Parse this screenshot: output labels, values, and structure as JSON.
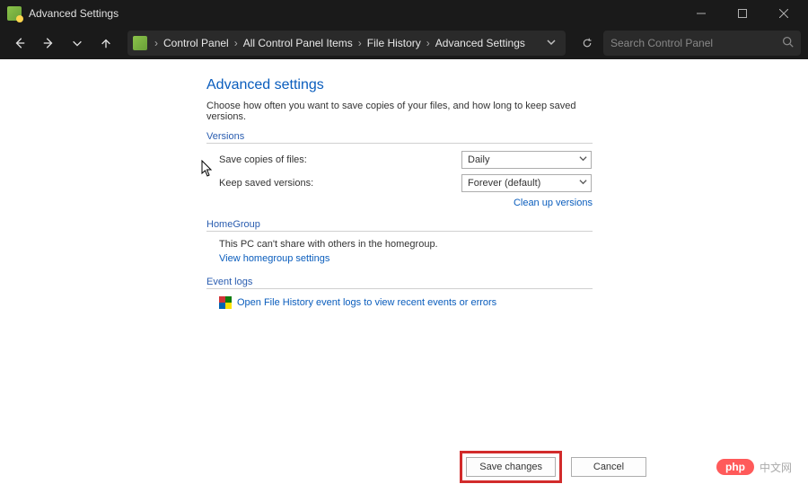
{
  "colors": {
    "link": "#0a5dbd",
    "highlight": "#d22b2b"
  },
  "window": {
    "title": "Advanced Settings"
  },
  "nav": {
    "breadcrumb": [
      "Control Panel",
      "All Control Panel Items",
      "File History",
      "Advanced Settings"
    ]
  },
  "search": {
    "placeholder": "Search Control Panel"
  },
  "page": {
    "title": "Advanced settings",
    "description": "Choose how often you want to save copies of your files, and how long to keep saved versions."
  },
  "versions": {
    "header": "Versions",
    "save_label": "Save copies of files:",
    "save_value": "Daily",
    "keep_label": "Keep saved versions:",
    "keep_value": "Forever (default)",
    "cleanup_link": "Clean up versions"
  },
  "homegroup": {
    "header": "HomeGroup",
    "message": "This PC can't share with others in the homegroup.",
    "link": "View homegroup settings"
  },
  "eventlogs": {
    "header": "Event logs",
    "link": "Open File History event logs to view recent events or errors"
  },
  "actions": {
    "save": "Save changes",
    "cancel": "Cancel"
  },
  "watermark": {
    "badge": "php",
    "text": "中文网"
  }
}
